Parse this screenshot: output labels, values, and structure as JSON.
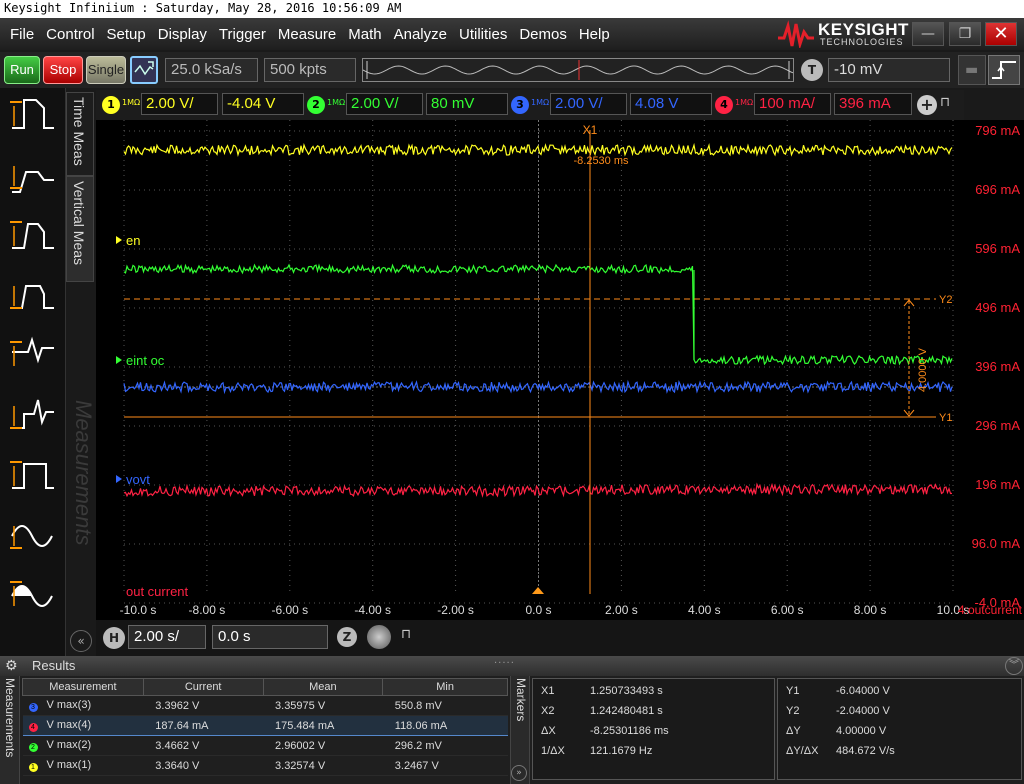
{
  "window": {
    "title": "Keysight Infiniium : Saturday, May 28, 2016 10:56:09 AM",
    "brand": "KEYSIGHT",
    "brand_sub": "TECHNOLOGIES"
  },
  "menu": [
    "File",
    "Control",
    "Setup",
    "Display",
    "Trigger",
    "Measure",
    "Math",
    "Analyze",
    "Utilities",
    "Demos",
    "Help"
  ],
  "toolbar": {
    "run": "Run",
    "stop": "Stop",
    "single": "Single",
    "sample_rate": "25.0 kSa/s",
    "memory_depth": "500 kpts",
    "trigger_badge": "T",
    "trigger_level": "-10 mV"
  },
  "side_tabs": {
    "time_meas": "Time Meas",
    "vertical_meas": "Vertical Meas",
    "watermark": "Measurements"
  },
  "channels": [
    {
      "num": "1",
      "impedance": "1MΩ",
      "scale": "2.00 V/",
      "offset": "-4.04 V",
      "color": "#ffff22"
    },
    {
      "num": "2",
      "impedance": "1MΩ",
      "scale": "2.00 V/",
      "offset": "80 mV",
      "color": "#33ff33"
    },
    {
      "num": "3",
      "impedance": "1MΩ",
      "scale": "2.00 V/",
      "offset": "4.08 V",
      "color": "#3366ff"
    },
    {
      "num": "4",
      "impedance": "1MΩ",
      "scale": "100 mA/",
      "offset": "396 mA",
      "color": "#ff2244"
    }
  ],
  "waveform_labels": {
    "ch1": "en",
    "ch2": "eint oc",
    "ch3": "vovt",
    "ch4": "out current",
    "ch4_axis": "4:outcurrent"
  },
  "markers_overlay": {
    "x1_label": "X1",
    "x1_time": "-8.2530 ms",
    "y1_label": "Y1",
    "y2_label": "Y2",
    "dy_label": "4.0000 V"
  },
  "y_ticks": [
    "796 mA",
    "696 mA",
    "596 mA",
    "496 mA",
    "396 mA",
    "296 mA",
    "196 mA",
    "96.0 mA",
    "-4.0 mA"
  ],
  "x_ticks": [
    "-10.0 s",
    "-8.00 s",
    "-6.00 s",
    "-4.00 s",
    "-2.00 s",
    "0.0 s",
    "2.00 s",
    "4.00 s",
    "6.00 s",
    "8.00 s",
    "10.0 s"
  ],
  "timebase": {
    "badge": "H",
    "time_per_div": "2.00 s/",
    "delay": "0.0 s",
    "zoom": "Z"
  },
  "results": {
    "title": "Results",
    "side_tab": "Measurements",
    "columns": [
      "Measurement",
      "Current",
      "Mean",
      "Min"
    ],
    "rows": [
      {
        "ch": "3",
        "color": "#3366ff",
        "name": "V max(3)",
        "current": "3.3962 V",
        "mean": "3.35975 V",
        "min": "550.8 mV"
      },
      {
        "ch": "4",
        "color": "#ff2244",
        "name": "V max(4)",
        "current": "187.64 mA",
        "mean": "175.484 mA",
        "min": "118.06 mA"
      },
      {
        "ch": "2",
        "color": "#33ff33",
        "name": "V max(2)",
        "current": "3.4662 V",
        "mean": "2.96002 V",
        "min": "296.2 mV"
      },
      {
        "ch": "1",
        "color": "#ffff22",
        "name": "V max(1)",
        "current": "3.3640 V",
        "mean": "3.32574 V",
        "min": "3.2467 V"
      }
    ],
    "selected_row": 1
  },
  "markers_panel": {
    "tab": "Markers",
    "x": [
      {
        "label": "X1",
        "value": "1.250733493 s"
      },
      {
        "label": "X2",
        "value": "1.242480481 s"
      },
      {
        "label": "ΔX",
        "value": "-8.25301186 ms"
      },
      {
        "label": "1/ΔX",
        "value": "121.1679 Hz"
      }
    ],
    "y": [
      {
        "label": "Y1",
        "value": "-6.04000 V"
      },
      {
        "label": "Y2",
        "value": "-2.04000 V"
      },
      {
        "label": "ΔY",
        "value": "4.00000 V"
      },
      {
        "label": "ΔY/ΔX",
        "value": "484.672 V/s"
      }
    ]
  }
}
